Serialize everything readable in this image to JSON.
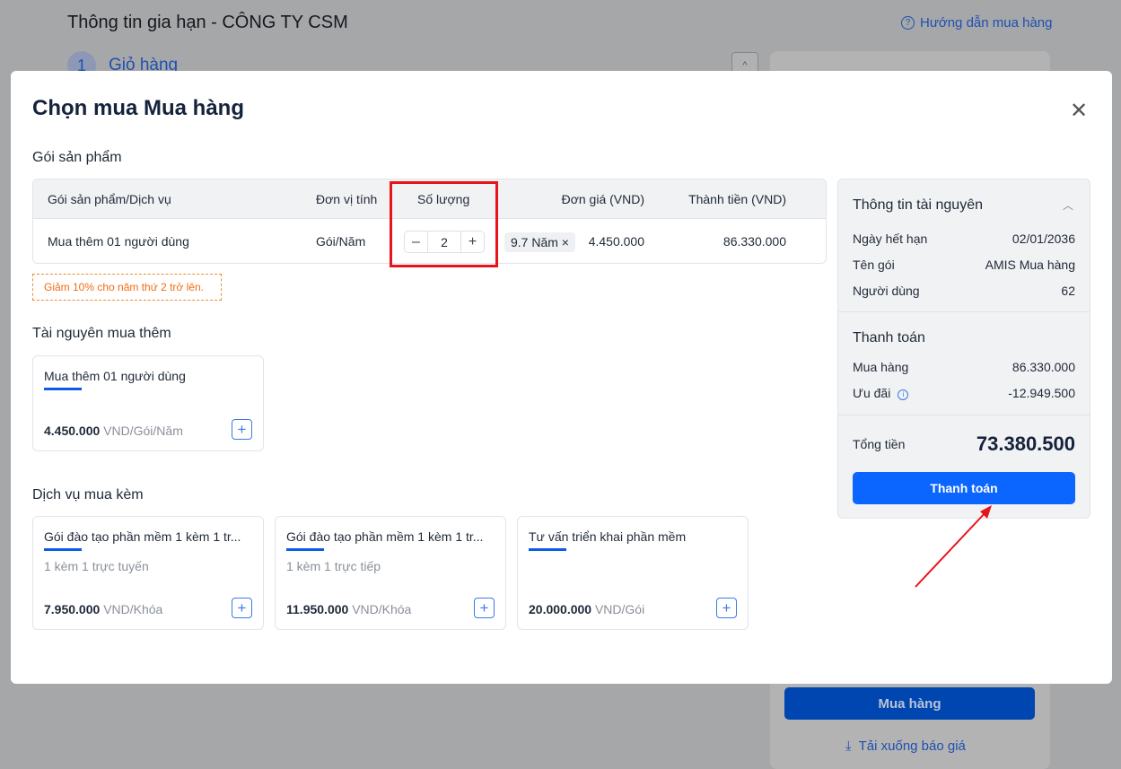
{
  "background": {
    "title": "Thông tin gia hạn - CÔNG TY CSM",
    "help": "Hướng dẫn mua hàng",
    "step_num": "1",
    "step_label": "Giỏ hàng",
    "buy": "Mua hàng",
    "download": "Tải xuống báo giá"
  },
  "modal": {
    "title": "Chọn mua Mua hàng",
    "product_section": "Gói sản phẩm",
    "columns": [
      "Gói sản phẩm/Dịch vụ",
      "Đơn vị tính",
      "Số lượng",
      "Đơn giá (VND)",
      "Thành tiền (VND)"
    ],
    "row": {
      "name": "Mua thêm 01 người dùng",
      "unit": "Gói/Năm",
      "qty": "2",
      "years": "9.7 Năm ×",
      "price": "4.450.000",
      "total": "86.330.000"
    },
    "promo": "Giảm 10% cho năm thứ 2 trở lên.",
    "resource_section": "Tài nguyên mua thêm",
    "resources": [
      {
        "name": "Mua thêm 01 người dùng",
        "price": "4.450.000",
        "unit": "VND/Gói/Năm"
      }
    ],
    "service_section": "Dịch vụ mua kèm",
    "services": [
      {
        "name": "Gói đào tạo phần mềm 1 kèm 1 tr...",
        "sub": "1 kèm 1 trực tuyến",
        "price": "7.950.000",
        "unit": "VND/Khóa"
      },
      {
        "name": "Gói đào tạo phần mềm 1 kèm 1 tr...",
        "sub": "1 kèm 1 trực tiếp",
        "price": "11.950.000",
        "unit": "VND/Khóa"
      },
      {
        "name": "Tư vấn triển khai phần mềm",
        "sub": "",
        "price": "20.000.000",
        "unit": "VND/Gói"
      }
    ],
    "summary": {
      "title": "Thông tin tài nguyên",
      "expiry_label": "Ngày hết hạn",
      "expiry": "02/01/2036",
      "pkg_label": "Tên gói",
      "pkg": "AMIS Mua hàng",
      "users_label": "Người dùng",
      "users": "62",
      "pay_title": "Thanh toán",
      "buy_label": "Mua hàng",
      "buy": "86.330.000",
      "disc_label": "Ưu đãi",
      "disc": "-12.949.500",
      "total_label": "Tổng tiền",
      "total": "73.380.500",
      "pay_button": "Thanh toán"
    }
  },
  "colors": {
    "primary": "#0a66ff",
    "annotation": "#e8141b",
    "promo": "#f06c12"
  }
}
